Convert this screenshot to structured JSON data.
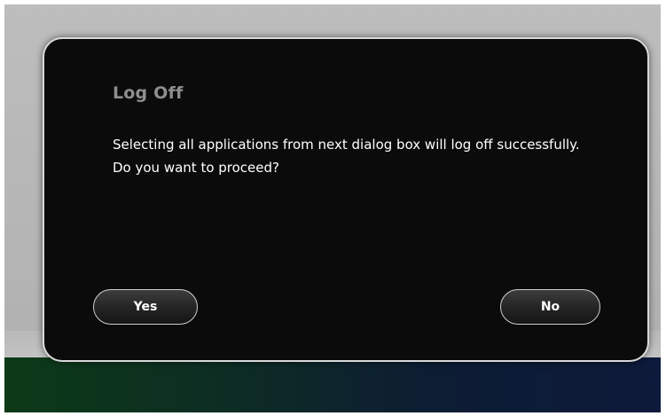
{
  "dialog": {
    "title": "Log Off",
    "message": "Selecting all applications from next dialog box will log off successfully. Do you want to proceed?",
    "yes_label": "Yes",
    "no_label": "No"
  }
}
